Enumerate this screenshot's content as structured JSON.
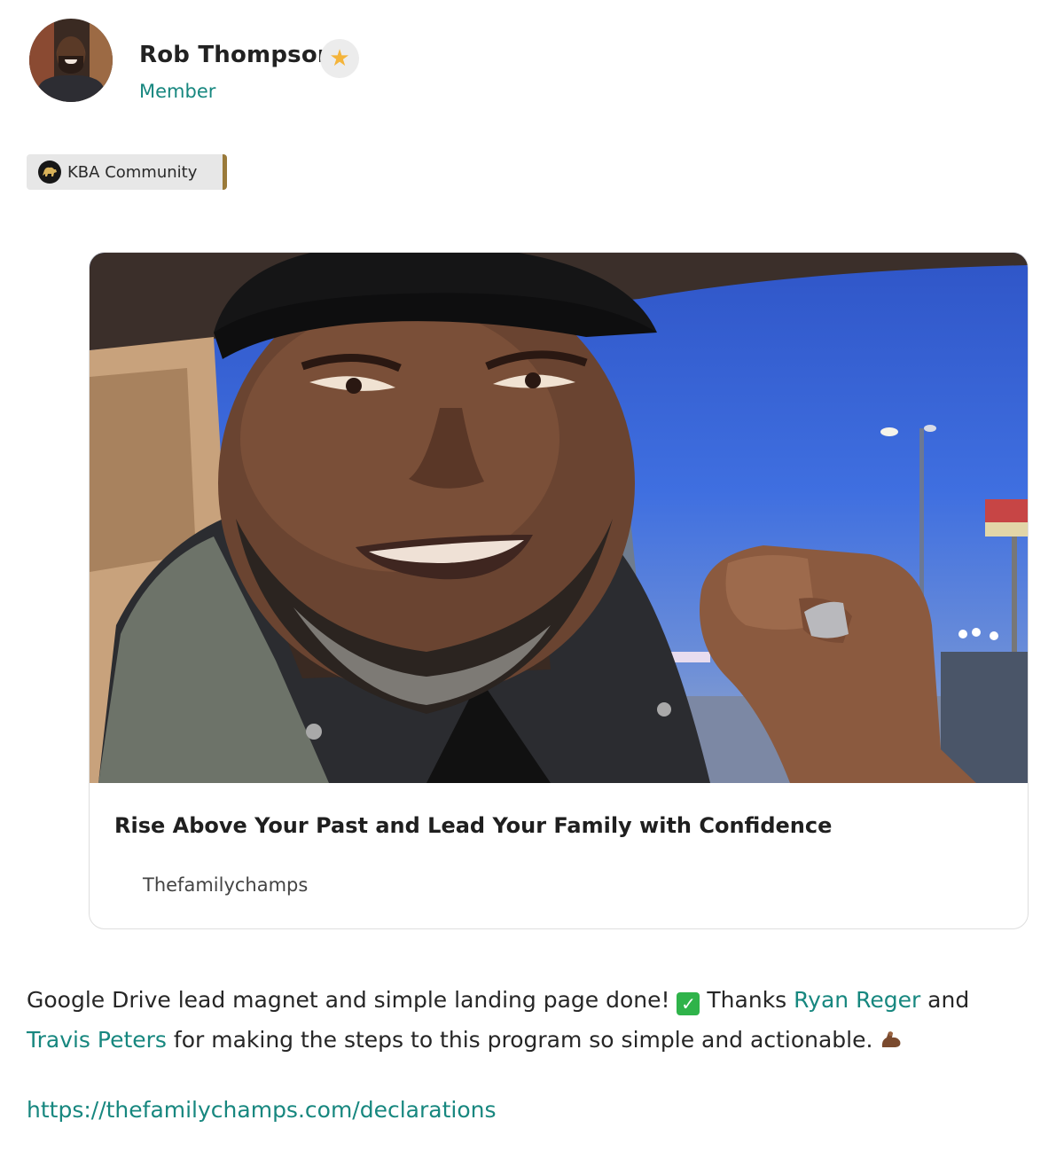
{
  "author": {
    "name": "Rob Thompson",
    "role": "Member",
    "badge_icon": "star-icon"
  },
  "community": {
    "label": "KBA Community",
    "accent": "#9a7a3a"
  },
  "link_card": {
    "title": "Rise Above Your Past and Lead Your Family with Confidence",
    "source": "Thefamilychamps"
  },
  "post": {
    "text_1": "Google Drive lead magnet and simple landing page done! ",
    "text_2": " Thanks ",
    "mention_1": "Ryan Reger",
    "text_3": " and ",
    "mention_2": "Travis Peters",
    "text_4": " for making the steps to this program so simple and actionable. ",
    "link": "https://thefamilychamps.com/declarations"
  },
  "colors": {
    "accent_teal": "#17877f",
    "check_green": "#2fb34a"
  }
}
